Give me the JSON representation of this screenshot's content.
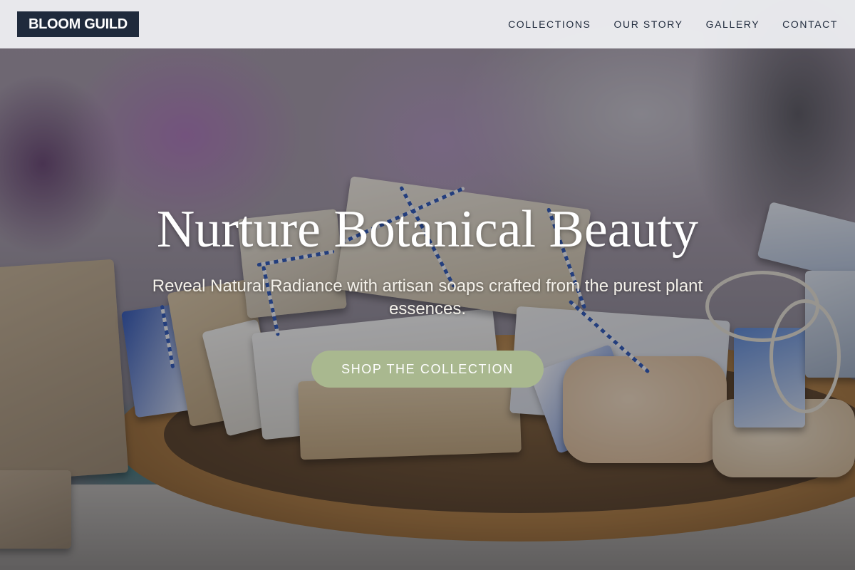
{
  "brand": {
    "logo_text": "BLOOM GUILD",
    "logo_bg": "#1f2a3c",
    "accent": "#a9b88f"
  },
  "nav": {
    "items": [
      {
        "label": "COLLECTIONS"
      },
      {
        "label": "OUR STORY"
      },
      {
        "label": "GALLERY"
      },
      {
        "label": "CONTACT"
      }
    ]
  },
  "hero": {
    "title": "Nurture Botanical Beauty",
    "subtitle": "Reveal Natural Radiance with artisan soaps crafted from the purest plant essences.",
    "cta_label": "SHOP THE COLLECTION",
    "background_image_subject": "handmade soap bars tied with blue and white twine on a wooden plate"
  }
}
